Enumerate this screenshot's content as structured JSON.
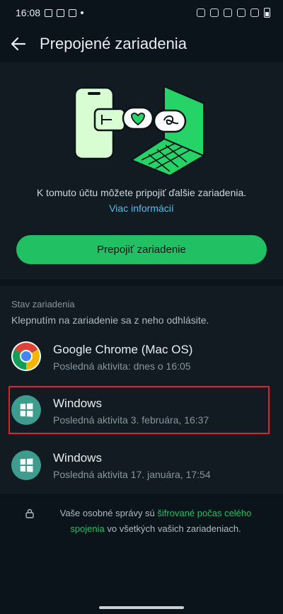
{
  "status": {
    "time": "16:08"
  },
  "appbar": {
    "title": "Prepojené zariadenia"
  },
  "intro": {
    "description": "K tomuto účtu môžete pripojiť ďalšie zariadenia.",
    "more_info": "Viac informácií",
    "link_button": "Prepojiť zariadenie"
  },
  "devices": {
    "section_title": "Stav zariadenia",
    "section_hint": "Klepnutím na zariadenie sa z neho odhlásite.",
    "items": [
      {
        "name": "Google Chrome (Mac OS)",
        "activity": "Posledná aktivita: dnes o 16:05",
        "icon": "chrome-icon"
      },
      {
        "name": "Windows",
        "activity": "Posledná aktivita 3. februára, 16:37",
        "icon": "windows-icon"
      },
      {
        "name": "Windows",
        "activity": "Posledná aktivita 17. januára, 17:54",
        "icon": "windows-icon"
      }
    ]
  },
  "footer": {
    "text_before": "Vaše osobné správy sú ",
    "encrypted": "šifrované počas celého spojenia",
    "text_after": " vo všetkých vašich zariadeniach."
  },
  "colors": {
    "background": "#0b141a",
    "surface": "#111b21",
    "accent": "#21c063",
    "link": "#53bdeb",
    "highlight": "#e1202a"
  }
}
